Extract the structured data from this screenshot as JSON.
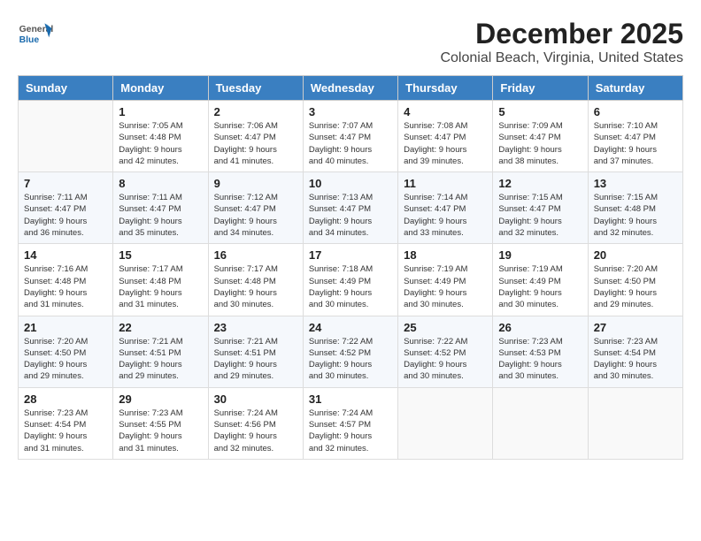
{
  "header": {
    "logo_general": "General",
    "logo_blue": "Blue",
    "title": "December 2025",
    "subtitle": "Colonial Beach, Virginia, United States"
  },
  "calendar": {
    "days_of_week": [
      "Sunday",
      "Monday",
      "Tuesday",
      "Wednesday",
      "Thursday",
      "Friday",
      "Saturday"
    ],
    "weeks": [
      [
        {
          "day": "",
          "info": ""
        },
        {
          "day": "1",
          "info": "Sunrise: 7:05 AM\nSunset: 4:48 PM\nDaylight: 9 hours\nand 42 minutes."
        },
        {
          "day": "2",
          "info": "Sunrise: 7:06 AM\nSunset: 4:47 PM\nDaylight: 9 hours\nand 41 minutes."
        },
        {
          "day": "3",
          "info": "Sunrise: 7:07 AM\nSunset: 4:47 PM\nDaylight: 9 hours\nand 40 minutes."
        },
        {
          "day": "4",
          "info": "Sunrise: 7:08 AM\nSunset: 4:47 PM\nDaylight: 9 hours\nand 39 minutes."
        },
        {
          "day": "5",
          "info": "Sunrise: 7:09 AM\nSunset: 4:47 PM\nDaylight: 9 hours\nand 38 minutes."
        },
        {
          "day": "6",
          "info": "Sunrise: 7:10 AM\nSunset: 4:47 PM\nDaylight: 9 hours\nand 37 minutes."
        }
      ],
      [
        {
          "day": "7",
          "info": "Sunrise: 7:11 AM\nSunset: 4:47 PM\nDaylight: 9 hours\nand 36 minutes."
        },
        {
          "day": "8",
          "info": "Sunrise: 7:11 AM\nSunset: 4:47 PM\nDaylight: 9 hours\nand 35 minutes."
        },
        {
          "day": "9",
          "info": "Sunrise: 7:12 AM\nSunset: 4:47 PM\nDaylight: 9 hours\nand 34 minutes."
        },
        {
          "day": "10",
          "info": "Sunrise: 7:13 AM\nSunset: 4:47 PM\nDaylight: 9 hours\nand 34 minutes."
        },
        {
          "day": "11",
          "info": "Sunrise: 7:14 AM\nSunset: 4:47 PM\nDaylight: 9 hours\nand 33 minutes."
        },
        {
          "day": "12",
          "info": "Sunrise: 7:15 AM\nSunset: 4:47 PM\nDaylight: 9 hours\nand 32 minutes."
        },
        {
          "day": "13",
          "info": "Sunrise: 7:15 AM\nSunset: 4:48 PM\nDaylight: 9 hours\nand 32 minutes."
        }
      ],
      [
        {
          "day": "14",
          "info": "Sunrise: 7:16 AM\nSunset: 4:48 PM\nDaylight: 9 hours\nand 31 minutes."
        },
        {
          "day": "15",
          "info": "Sunrise: 7:17 AM\nSunset: 4:48 PM\nDaylight: 9 hours\nand 31 minutes."
        },
        {
          "day": "16",
          "info": "Sunrise: 7:17 AM\nSunset: 4:48 PM\nDaylight: 9 hours\nand 30 minutes."
        },
        {
          "day": "17",
          "info": "Sunrise: 7:18 AM\nSunset: 4:49 PM\nDaylight: 9 hours\nand 30 minutes."
        },
        {
          "day": "18",
          "info": "Sunrise: 7:19 AM\nSunset: 4:49 PM\nDaylight: 9 hours\nand 30 minutes."
        },
        {
          "day": "19",
          "info": "Sunrise: 7:19 AM\nSunset: 4:49 PM\nDaylight: 9 hours\nand 30 minutes."
        },
        {
          "day": "20",
          "info": "Sunrise: 7:20 AM\nSunset: 4:50 PM\nDaylight: 9 hours\nand 29 minutes."
        }
      ],
      [
        {
          "day": "21",
          "info": "Sunrise: 7:20 AM\nSunset: 4:50 PM\nDaylight: 9 hours\nand 29 minutes."
        },
        {
          "day": "22",
          "info": "Sunrise: 7:21 AM\nSunset: 4:51 PM\nDaylight: 9 hours\nand 29 minutes."
        },
        {
          "day": "23",
          "info": "Sunrise: 7:21 AM\nSunset: 4:51 PM\nDaylight: 9 hours\nand 29 minutes."
        },
        {
          "day": "24",
          "info": "Sunrise: 7:22 AM\nSunset: 4:52 PM\nDaylight: 9 hours\nand 30 minutes."
        },
        {
          "day": "25",
          "info": "Sunrise: 7:22 AM\nSunset: 4:52 PM\nDaylight: 9 hours\nand 30 minutes."
        },
        {
          "day": "26",
          "info": "Sunrise: 7:23 AM\nSunset: 4:53 PM\nDaylight: 9 hours\nand 30 minutes."
        },
        {
          "day": "27",
          "info": "Sunrise: 7:23 AM\nSunset: 4:54 PM\nDaylight: 9 hours\nand 30 minutes."
        }
      ],
      [
        {
          "day": "28",
          "info": "Sunrise: 7:23 AM\nSunset: 4:54 PM\nDaylight: 9 hours\nand 31 minutes."
        },
        {
          "day": "29",
          "info": "Sunrise: 7:23 AM\nSunset: 4:55 PM\nDaylight: 9 hours\nand 31 minutes."
        },
        {
          "day": "30",
          "info": "Sunrise: 7:24 AM\nSunset: 4:56 PM\nDaylight: 9 hours\nand 32 minutes."
        },
        {
          "day": "31",
          "info": "Sunrise: 7:24 AM\nSunset: 4:57 PM\nDaylight: 9 hours\nand 32 minutes."
        },
        {
          "day": "",
          "info": ""
        },
        {
          "day": "",
          "info": ""
        },
        {
          "day": "",
          "info": ""
        }
      ]
    ]
  }
}
